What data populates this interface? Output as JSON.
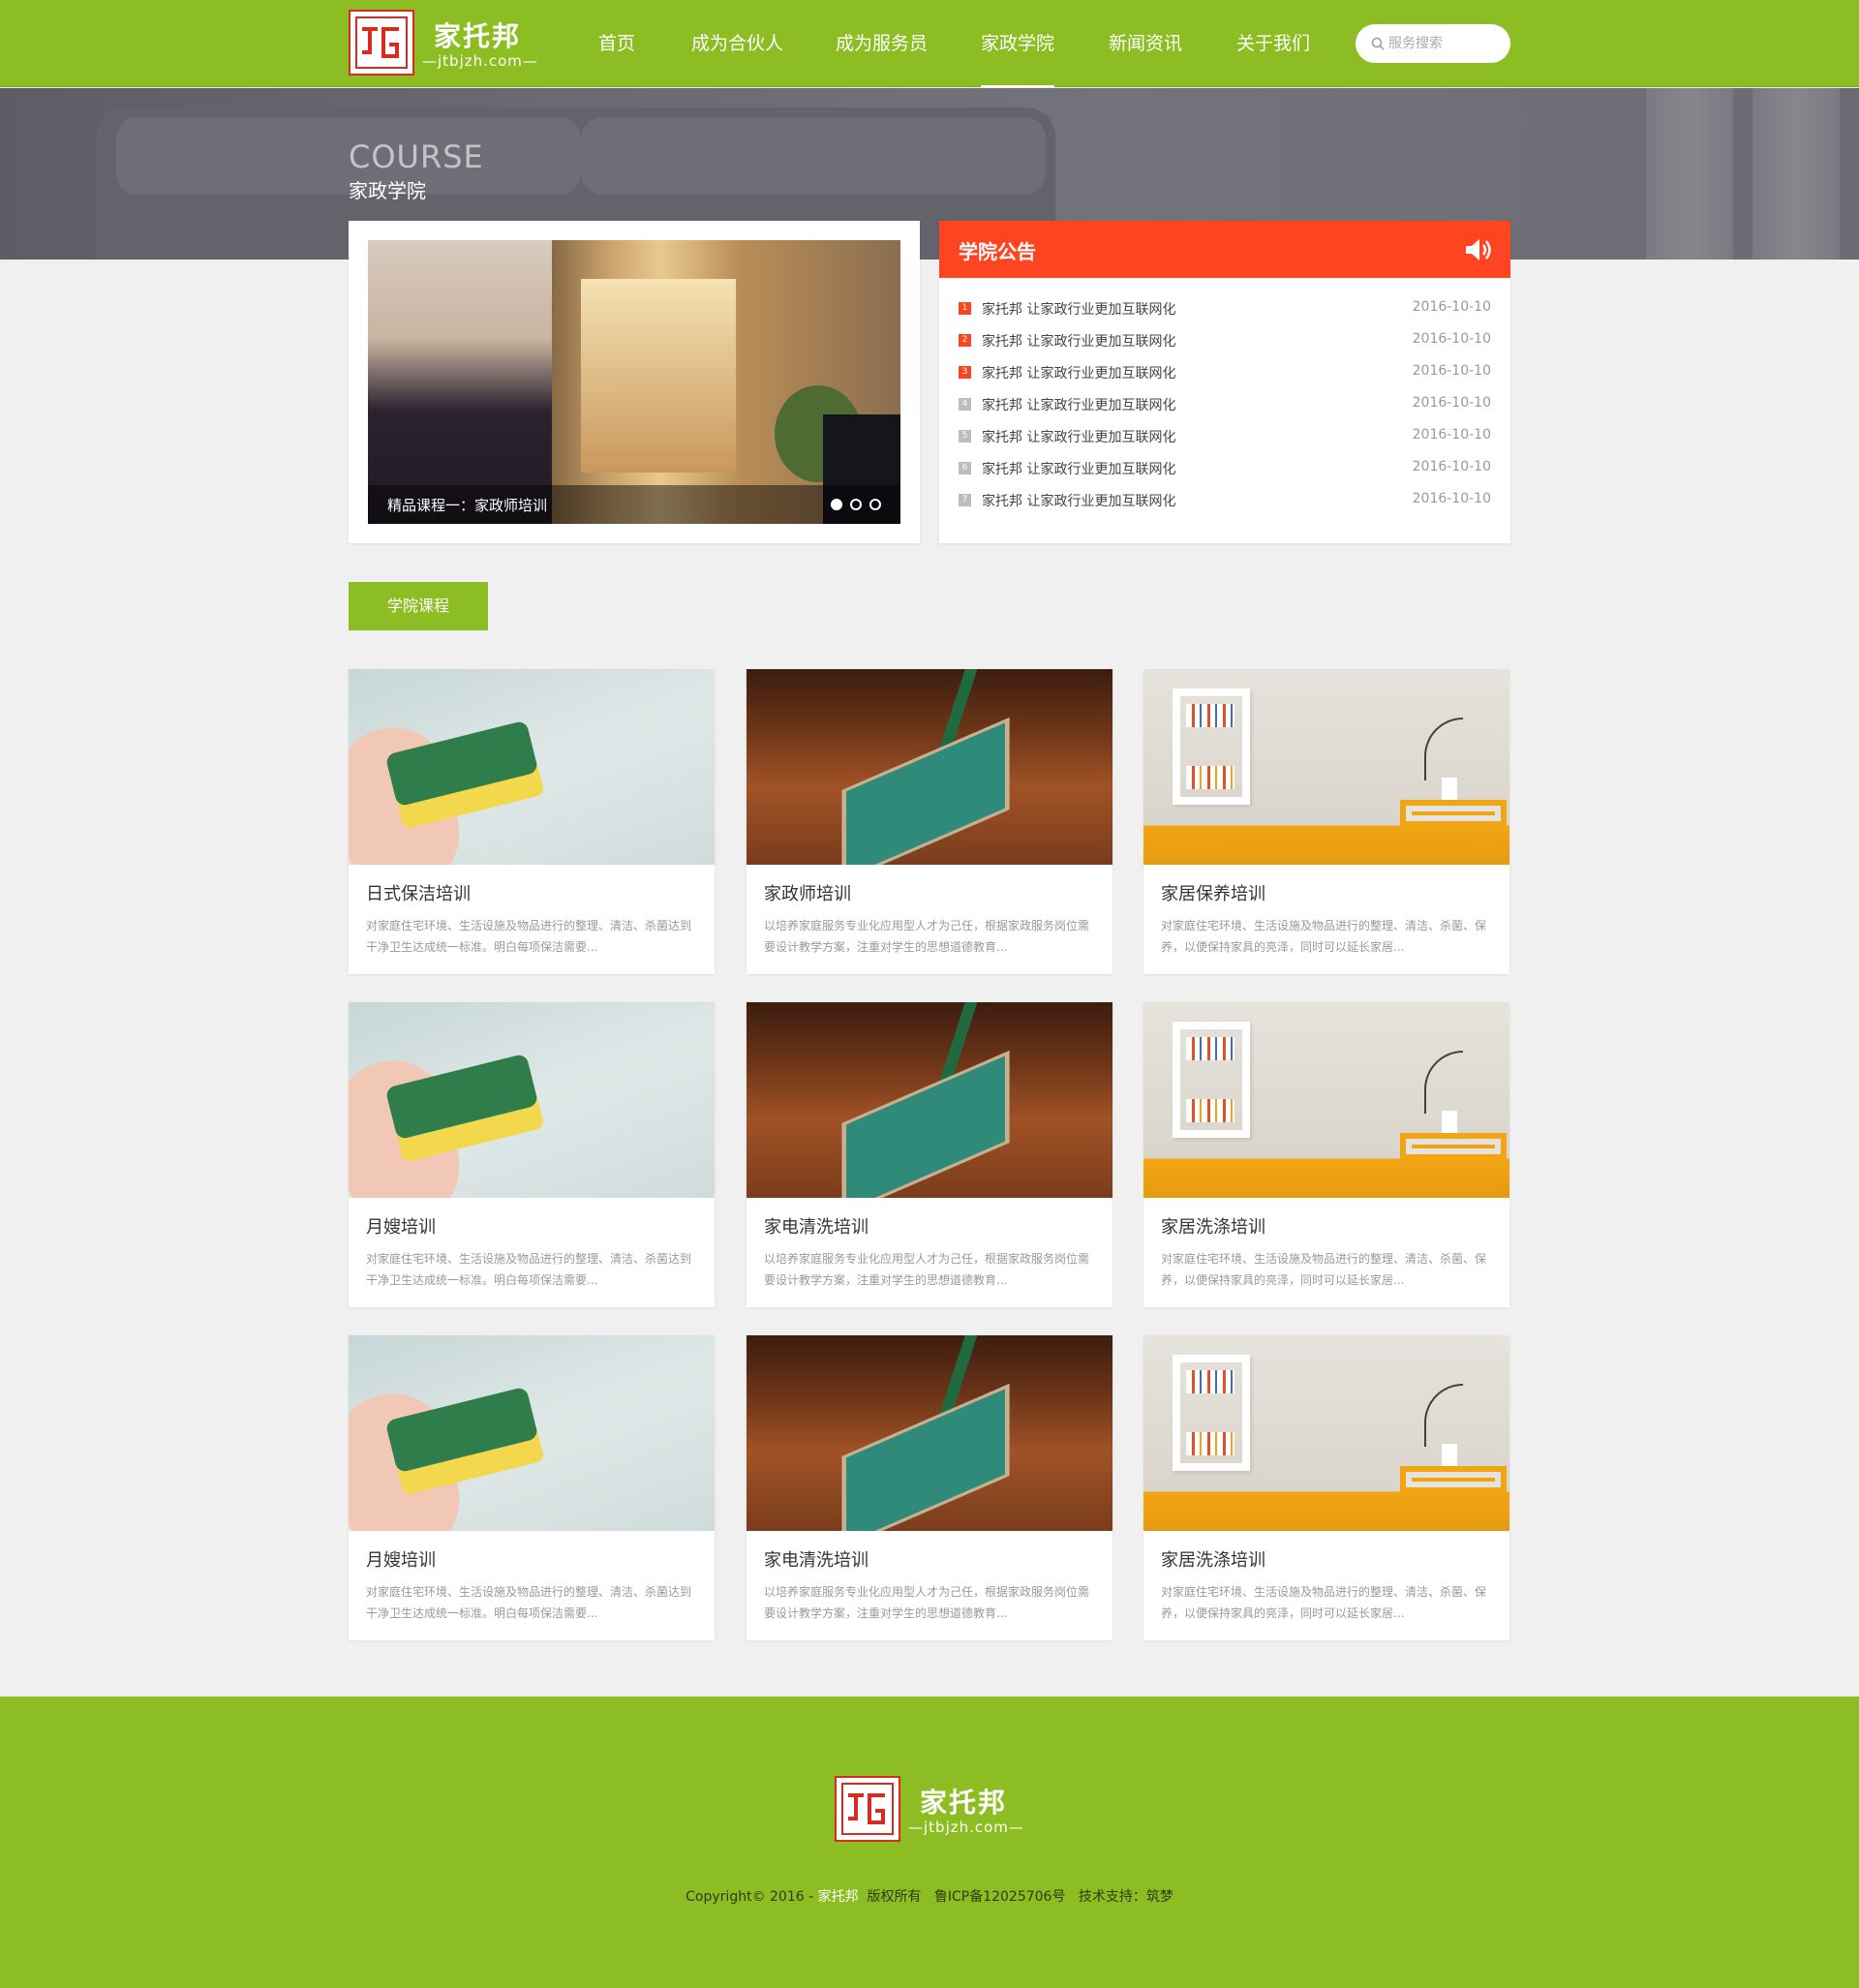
{
  "brand": {
    "name": "家托邦",
    "domain": "—jtbjzh.com—"
  },
  "nav": {
    "items": [
      {
        "label": "首页",
        "active": false
      },
      {
        "label": "成为合伙人",
        "active": false
      },
      {
        "label": "成为服务员",
        "active": false
      },
      {
        "label": "家政学院",
        "active": true
      },
      {
        "label": "新闻资讯",
        "active": false
      },
      {
        "label": "关于我们",
        "active": false
      }
    ],
    "search_placeholder": "服务搜索"
  },
  "banner": {
    "title_en": "COURSE",
    "title_cn": "家政学院"
  },
  "slider": {
    "caption": "精品课程一：家政师培训",
    "total_dots": 3,
    "active_dot": 0
  },
  "notice": {
    "title": "学院公告",
    "items": [
      {
        "num": "1",
        "text": "家托邦 让家政行业更加互联网化",
        "date": "2016-10-10"
      },
      {
        "num": "2",
        "text": "家托邦 让家政行业更加互联网化",
        "date": "2016-10-10"
      },
      {
        "num": "3",
        "text": "家托邦 让家政行业更加互联网化",
        "date": "2016-10-10"
      },
      {
        "num": "4",
        "text": "家托邦 让家政行业更加互联网化",
        "date": "2016-10-10"
      },
      {
        "num": "5",
        "text": "家托邦 让家政行业更加互联网化",
        "date": "2016-10-10"
      },
      {
        "num": "6",
        "text": "家托邦 让家政行业更加互联网化",
        "date": "2016-10-10"
      },
      {
        "num": "7",
        "text": "家托邦 让家政行业更加互联网化",
        "date": "2016-10-10"
      }
    ]
  },
  "section_button": "学院课程",
  "courses": [
    {
      "title": "日式保洁培训",
      "desc": "对家庭住宅环境、生活设施及物品进行的整理、清洁、杀菌达到干净卫生达成统一标准。明白每项保洁需要...",
      "image": "sponge"
    },
    {
      "title": "家政师培训",
      "desc": "以培养家庭服务专业化应用型人才为己任，根据家政服务岗位需要设计教学方案，注重对学生的思想道德教育...",
      "image": "mop"
    },
    {
      "title": "家居保养培训",
      "desc": "对家庭住宅环境、生活设施及物品进行的整理、清洁、杀菌、保养，以便保持家具的亮泽，同时可以延长家居...",
      "image": "shelf"
    },
    {
      "title": "月嫂培训",
      "desc": "对家庭住宅环境、生活设施及物品进行的整理、清洁、杀菌达到干净卫生达成统一标准。明白每项保洁需要...",
      "image": "sponge"
    },
    {
      "title": "家电清洗培训",
      "desc": "以培养家庭服务专业化应用型人才为己任，根据家政服务岗位需要设计教学方案，注重对学生的思想道德教育...",
      "image": "mop"
    },
    {
      "title": "家居洗涤培训",
      "desc": "对家庭住宅环境、生活设施及物品进行的整理、清洁、杀菌、保养，以便保持家具的亮泽，同时可以延长家居...",
      "image": "shelf"
    },
    {
      "title": "月嫂培训",
      "desc": "对家庭住宅环境、生活设施及物品进行的整理、清洁、杀菌达到干净卫生达成统一标准。明白每项保洁需要...",
      "image": "sponge"
    },
    {
      "title": "家电清洗培训",
      "desc": "以培养家庭服务专业化应用型人才为己任，根据家政服务岗位需要设计教学方案，注重对学生的思想道德教育...",
      "image": "mop"
    },
    {
      "title": "家居洗涤培训",
      "desc": "对家庭住宅环境、生活设施及物品进行的整理、清洁、杀菌、保养，以便保持家具的亮泽，同时可以延长家居...",
      "image": "shelf"
    }
  ],
  "footer": {
    "copy_prefix": "Copyright© 2016 - ",
    "copy_brand": "家托邦",
    "copy_suffix": "  版权所有   鲁ICP备12025706号   技术支持：筑梦"
  },
  "colors": {
    "primary": "#8cbd22",
    "notice": "#ff4422",
    "logo_red": "#d92b20"
  }
}
